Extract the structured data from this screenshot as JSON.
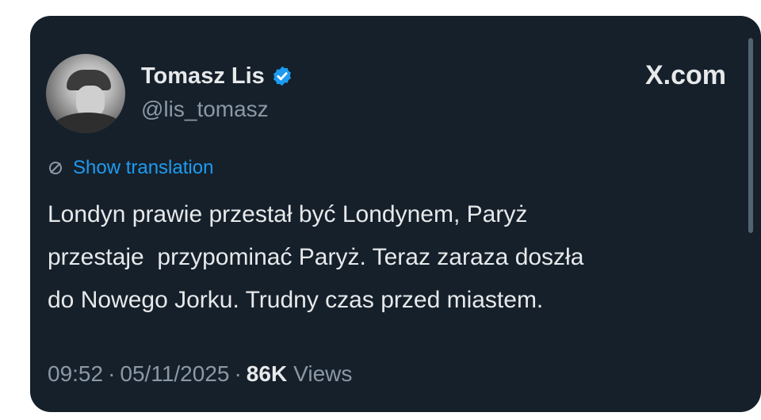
{
  "tweet": {
    "display_name": "Tomasz Lis",
    "handle": "@lis_tomasz",
    "source": "X.com",
    "translate_label": "Show translation",
    "text": "Londyn prawie przestał być Londynem, Paryż\nprzestaje  przypominać Paryż. Teraz zaraza doszła\ndo Nowego Jorku. Trudny czas przed miastem.",
    "time": "09:52",
    "date": "05/11/2025",
    "separator": "·",
    "views_count": "86K",
    "views_label": "Views"
  },
  "colors": {
    "background": "#15202b",
    "text": "#e7e9ea",
    "muted": "#8b98a5",
    "accent": "#1d9bf0"
  },
  "icons": {
    "verified": "verified-badge-icon",
    "translate": "globe-icon"
  }
}
